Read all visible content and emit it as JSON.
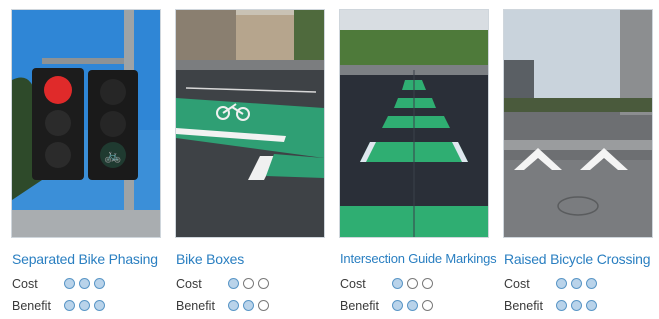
{
  "cards": [
    {
      "title": "Separated Bike Phasing",
      "cost_label": "Cost",
      "benefit_label": "Benefit",
      "cost": [
        1,
        1,
        1
      ],
      "benefit": [
        1,
        1,
        1
      ]
    },
    {
      "title": "Bike Boxes",
      "cost_label": "Cost",
      "benefit_label": "Benefit",
      "cost": [
        1,
        0,
        0
      ],
      "benefit": [
        1,
        1,
        0
      ]
    },
    {
      "title": "Intersection Guide Markings",
      "cost_label": "Cost",
      "benefit_label": "Benefit",
      "cost": [
        1,
        0,
        0
      ],
      "benefit": [
        1,
        1,
        0
      ]
    },
    {
      "title": "Raised Bicycle Crossing",
      "cost_label": "Cost",
      "benefit_label": "Benefit",
      "cost": [
        1,
        1,
        1
      ],
      "benefit": [
        1,
        1,
        1
      ]
    }
  ],
  "colors": {
    "accent": "#2a7fc1",
    "filled_dot": "#b9d3ea",
    "bike_green": "#2fae72"
  }
}
